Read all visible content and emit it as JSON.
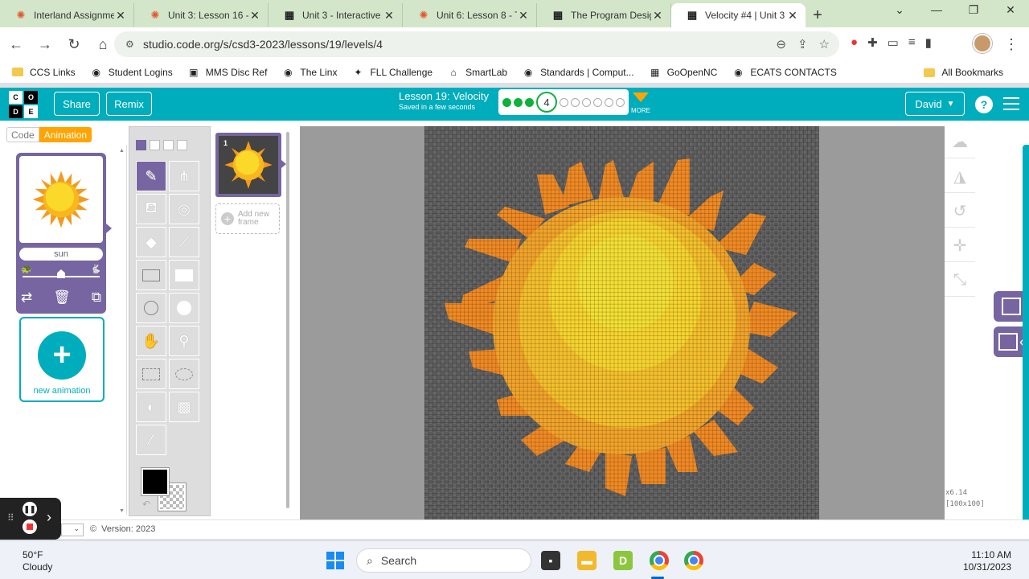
{
  "browser": {
    "tabs": [
      {
        "title": "Interland Assignme",
        "favicon": "gear-icon",
        "active": false
      },
      {
        "title": "Unit 3: Lesson 16 -",
        "favicon": "gear-icon",
        "active": false
      },
      {
        "title": "Unit 3 - Interactive",
        "favicon": "code-org-icon",
        "active": false
      },
      {
        "title": "Unit 6: Lesson 8 - T",
        "favicon": "gear-icon",
        "active": false
      },
      {
        "title": "The Program Desig",
        "favicon": "code-org-icon",
        "active": false
      },
      {
        "title": "Velocity #4 | Unit 3",
        "favicon": "code-org-icon",
        "active": true
      }
    ],
    "url": "studio.code.org/s/csd3-2023/lessons/19/levels/4",
    "bookmarks": [
      {
        "label": "CCS Links",
        "icon": "folder-icon"
      },
      {
        "label": "Student Logins",
        "icon": "globe-icon"
      },
      {
        "label": "MMS Disc Ref",
        "icon": "contact-icon"
      },
      {
        "label": "The Linx",
        "icon": "globe-icon"
      },
      {
        "label": "FLL Challenge",
        "icon": "fll-icon"
      },
      {
        "label": "SmartLab",
        "icon": "smartlab-icon"
      },
      {
        "label": "Standards | Comput...",
        "icon": "standards-icon"
      },
      {
        "label": "GoOpenNC",
        "icon": "goopen-icon"
      },
      {
        "label": "ECATS CONTACTS",
        "icon": "globe-icon"
      }
    ],
    "all_bookmarks": "All Bookmarks"
  },
  "header": {
    "logo_letters": [
      "C",
      "O",
      "D",
      "E"
    ],
    "share": "Share",
    "remix": "Remix",
    "lesson_title": "Lesson 19: Velocity",
    "saved_status": "Saved in a few seconds",
    "current_level": "4",
    "levels_done": 3,
    "levels_todo": 6,
    "more": "MORE",
    "user": "David",
    "help": "?",
    "accent_color": "#00adbc"
  },
  "mode_tabs": {
    "code": "Code",
    "animation": "Animation",
    "active": "Animation"
  },
  "animation_list": {
    "selected": {
      "name": "sun"
    },
    "speed_fraction": 0.5,
    "new_animation": "new animation"
  },
  "frames": {
    "items": [
      {
        "number": "1"
      }
    ],
    "add_new_frame": [
      "Add new",
      "frame"
    ]
  },
  "canvas": {
    "zoom": "x6.14",
    "dimensions": "[100x100]"
  },
  "footer": {
    "version": "Version: 2023"
  },
  "taskbar": {
    "temperature": "50°F",
    "condition": "Cloudy",
    "search": "Search",
    "time": "11:10 AM",
    "date": "10/31/2023"
  }
}
